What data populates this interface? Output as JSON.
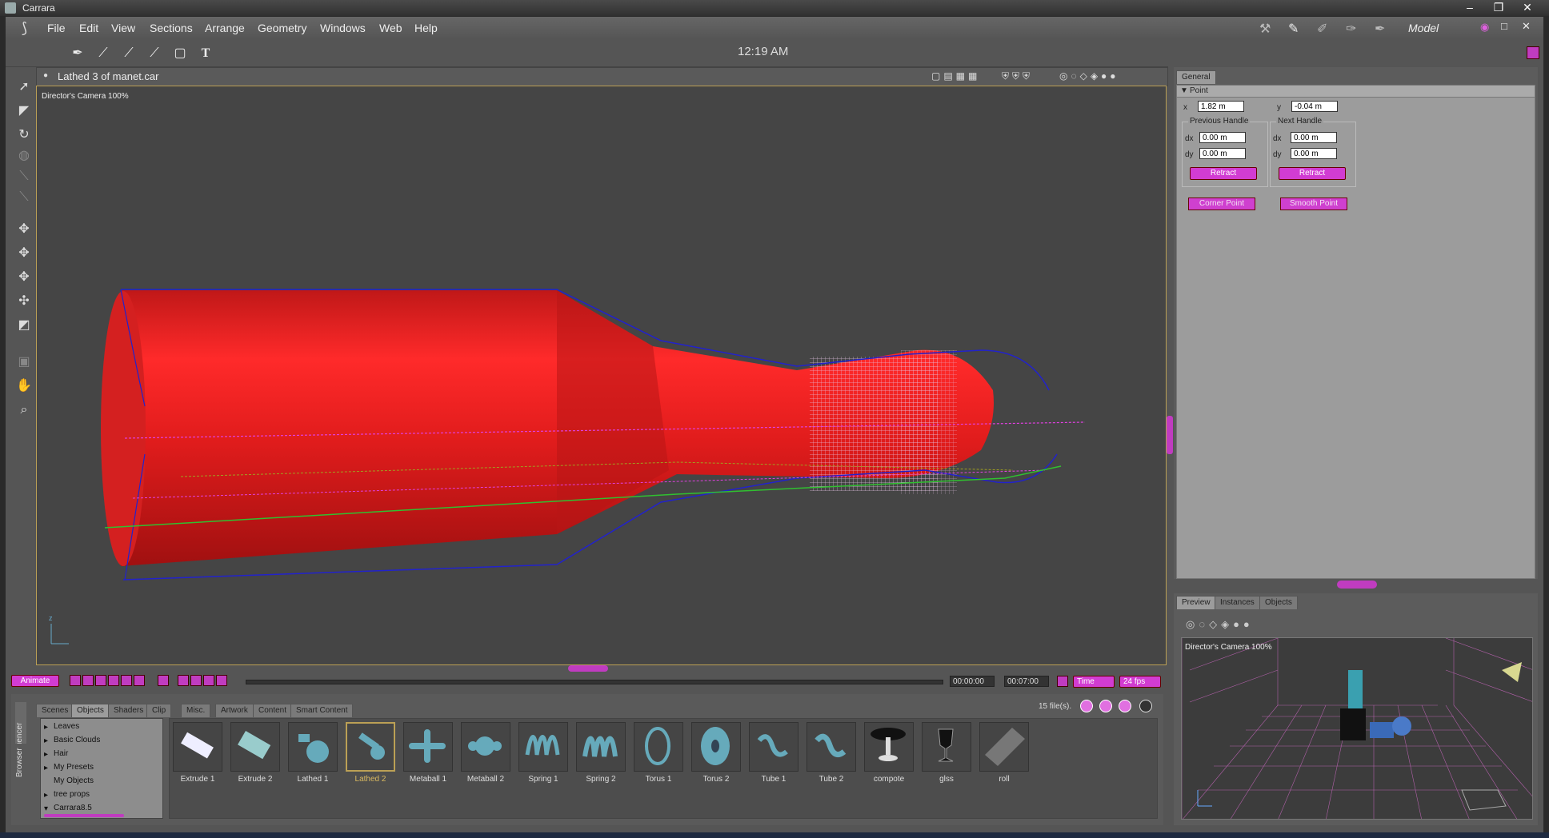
{
  "app": {
    "title": "Carrara"
  },
  "menu": [
    "File",
    "Edit",
    "View",
    "Sections",
    "Arrange",
    "Geometry",
    "Windows",
    "Web",
    "Help"
  ],
  "room": {
    "label": "Model"
  },
  "clock": "12:19 AM",
  "viewport": {
    "document_title": "Lathed 3 of manet.car",
    "camera_label": "Director's Camera 100%"
  },
  "properties": {
    "tab_general": "General",
    "section_point": "Point",
    "x_label": "x",
    "x_value": "1.82 m",
    "y_label": "y",
    "y_value": "-0.04 m",
    "prev_handle": {
      "title": "Previous Handle",
      "dx_label": "dx",
      "dx": "0.00 m",
      "dy_label": "dy",
      "dy": "0.00 m",
      "retract": "Retract"
    },
    "next_handle": {
      "title": "Next Handle",
      "dx_label": "dx",
      "dx": "0.00 m",
      "dy_label": "dy",
      "dy": "0.00 m",
      "retract": "Retract"
    },
    "corner_point": "Corner Point",
    "smooth_point": "Smooth Point"
  },
  "preview": {
    "tabs": [
      "Preview",
      "Instances",
      "Objects"
    ],
    "camera_label": "Director's Camera 100%"
  },
  "timeline": {
    "animate": "Animate",
    "time_start": "00:00:00",
    "time_end": "00:07:00",
    "mode": "Time",
    "fps": "24 fps"
  },
  "browser": {
    "tabs": [
      "Scenes",
      "Objects",
      "Shaders",
      "Clip",
      "Misc.",
      "Artwork",
      "Content",
      "Smart Content"
    ],
    "side_tabs": [
      "Sequencer",
      "Browser"
    ],
    "file_count": "15 file(s).",
    "categories": [
      "Leaves",
      "Basic Clouds",
      "Hair",
      "My Presets",
      "My Objects",
      "tree props",
      "Carrara8.5"
    ],
    "items": [
      "Extrude 1",
      "Extrude 2",
      "Lathed 1",
      "Lathed 2",
      "Metaball 1",
      "Metaball 2",
      "Spring 1",
      "Spring 2",
      "Torus 1",
      "Torus 2",
      "Tube 1",
      "Tube 2",
      "compote",
      "glss",
      "roll"
    ],
    "selected": "Lathed 2"
  },
  "colors": {
    "accent": "#d23cd2",
    "object": "#e02020",
    "panel": "#9c9c9c"
  }
}
